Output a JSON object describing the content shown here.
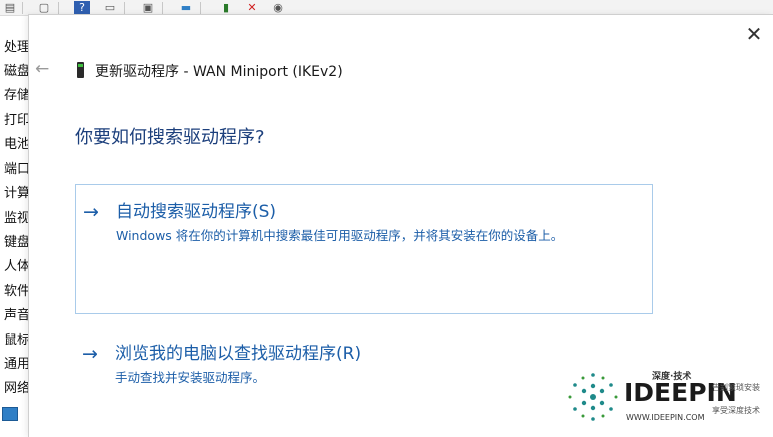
{
  "background": {
    "tree_items": [
      "处理",
      "磁盘",
      "存储",
      "打印",
      "电池",
      "端口",
      "计算",
      "监视",
      "键盘",
      "人体",
      "软件",
      "声音",
      "鼠标",
      "通用",
      "网络"
    ]
  },
  "dialog": {
    "title": "更新驱动程序 - WAN Miniport (IKEv2)",
    "close_glyph": "✕",
    "back_glyph": "←",
    "question": "你要如何搜索驱动程序?",
    "options": [
      {
        "arrow": "→",
        "title": "自动搜索驱动程序(S)",
        "description": "Windows 将在你的计算机中搜索最佳可用驱动程序，并将其安装在你的设备上。"
      },
      {
        "arrow": "→",
        "title": "浏览我的电脑以查找驱动程序(R)",
        "description": "手动查找并安装驱动程序。"
      }
    ]
  },
  "watermark": {
    "top": "深度·技术",
    "brand": "IDEEPIN",
    "url": "WWW.IDEEPIN.COM",
    "slogan1": "告别繁琐安装",
    "slogan2": "享受深度技术"
  },
  "colors": {
    "link_blue": "#1c5ea8",
    "heading_blue": "#1c3f7c",
    "selection_border": "#a9cbea"
  }
}
